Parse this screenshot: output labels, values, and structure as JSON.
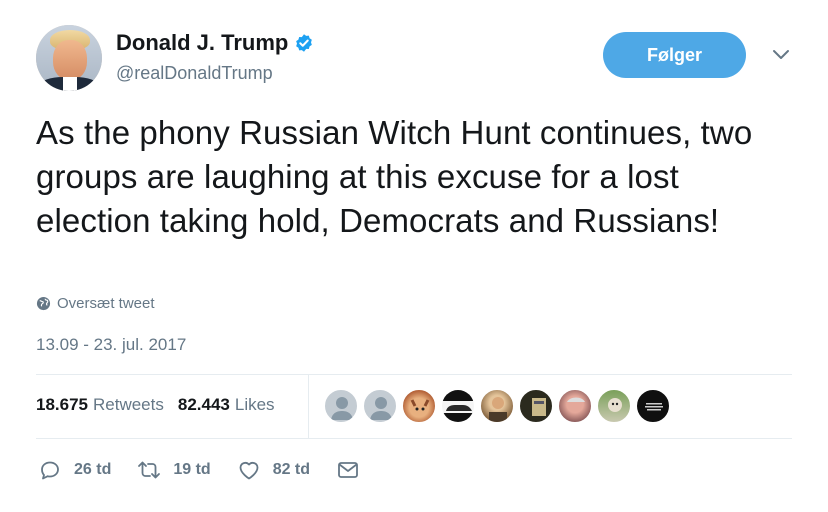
{
  "author": {
    "display_name": "Donald J. Trump",
    "handle": "@realDonaldTrump",
    "verified": true
  },
  "follow_button_label": "Følger",
  "tweet": {
    "text": "As the phony Russian Witch Hunt continues, two groups are laughing at this excuse for a lost election taking hold, Democrats and Russians!",
    "translate_label": "Oversæt tweet",
    "timestamp": "13.09 - 23. jul. 2017"
  },
  "stats": {
    "retweets_count": "18.675",
    "retweets_label": "Retweets",
    "likes_count": "82.443",
    "likes_label": "Likes"
  },
  "liker_avatars": [
    {
      "icon": "default-avatar",
      "color": "#c4ccd3"
    },
    {
      "icon": "default-avatar",
      "color": "#c4ccd3"
    },
    {
      "icon": "cat-photo",
      "color": "#d99a6c"
    },
    {
      "icon": "car-photo",
      "color": "#222222"
    },
    {
      "icon": "person-photo",
      "color": "#9a7a55"
    },
    {
      "icon": "landscape-photo",
      "color": "#6a6240"
    },
    {
      "icon": "face-photo",
      "color": "#c98a80"
    },
    {
      "icon": "dog-photo",
      "color": "#8a9a6a"
    },
    {
      "icon": "text-photo",
      "color": "#111111"
    }
  ],
  "actions": {
    "reply_count": "26 td",
    "retweet_count": "19 td",
    "like_count": "82 td"
  },
  "colors": {
    "accent": "#4ea8e6",
    "muted": "#657786",
    "verified": "#1da1f2"
  }
}
